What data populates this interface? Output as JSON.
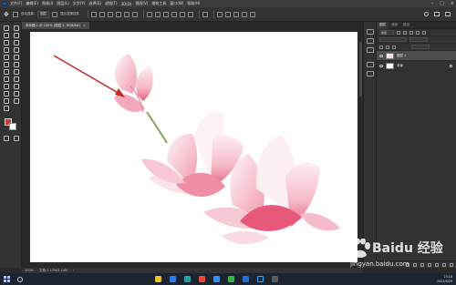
{
  "app": {
    "logo_text": "Ps"
  },
  "menu": [
    "文件(F)",
    "编辑(E)",
    "图像(I)",
    "图层(L)",
    "文字(Y)",
    "选择(S)",
    "滤镜(T)",
    "3D(D)",
    "视图(V)",
    "增效工具",
    "窗口(W)",
    "帮助(H)"
  ],
  "options_bar": {
    "auto_select": "自动选择:",
    "layer_dropdown": "图层",
    "transform": "显示变换控件"
  },
  "document_tab": {
    "title": "未标题-1 @ 100% (图层 1, RGB/8#)",
    "close": "×"
  },
  "status_bar": {
    "zoom": "100%",
    "doc_info": "文档:7.17M/3.14M"
  },
  "layers_panel": {
    "tabs": [
      "图层",
      "通道",
      "路径"
    ],
    "kind_label": "类型",
    "layers": [
      {
        "name": "图层 1",
        "selected": true,
        "thumb": "flower"
      },
      {
        "name": "背景",
        "selected": false,
        "thumb": "white"
      }
    ]
  },
  "taskbar": {
    "time": "23:10",
    "date": "2022/4/29"
  },
  "watermark": {
    "brand": "Baidu 经验",
    "url": "jingyan.baidu.com"
  },
  "colors": {
    "accent": "#31a8ff",
    "foreground_swatch": "#c93b3b",
    "background_swatch": "#ffffff",
    "arrow": "#c62828",
    "petal": "#f2a6b8"
  }
}
